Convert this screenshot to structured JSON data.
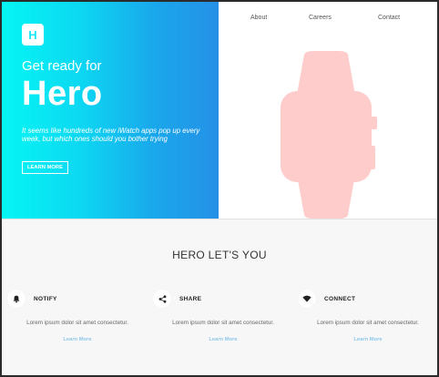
{
  "colors": {
    "hero_gradient_start": "#05f6f4",
    "hero_gradient_end": "#2590e6",
    "watch_color": "#ffcccc",
    "link_color": "#8dc7ea",
    "features_bg": "#f7f7f7"
  },
  "hero": {
    "logo_letter": "H",
    "tagline": "Get ready for",
    "title": "Hero",
    "description": "It seems like hundreds of new iWatch apps pop up every week, but which ones should you bother trying",
    "cta_label": "LEARN MORE",
    "image_icon": "smartwatch-icon"
  },
  "nav": {
    "items": [
      "About",
      "Careers",
      "Contact"
    ]
  },
  "features": {
    "title": "HERO LET'S YOU",
    "items": [
      {
        "icon": "bell-icon",
        "label": "NOTIFY",
        "text": "Lorem ipsum dolor sit amet consectetur.",
        "link": "Learn More"
      },
      {
        "icon": "share-icon",
        "label": "SHARE",
        "text": "Lorem ipsum dolor sit amet consectetur.",
        "link": "Learn More"
      },
      {
        "icon": "wifi-icon",
        "label": "CONNECT",
        "text": "Lorem ipsum dolor sit amet consectetur.",
        "link": "Learn More"
      }
    ]
  }
}
